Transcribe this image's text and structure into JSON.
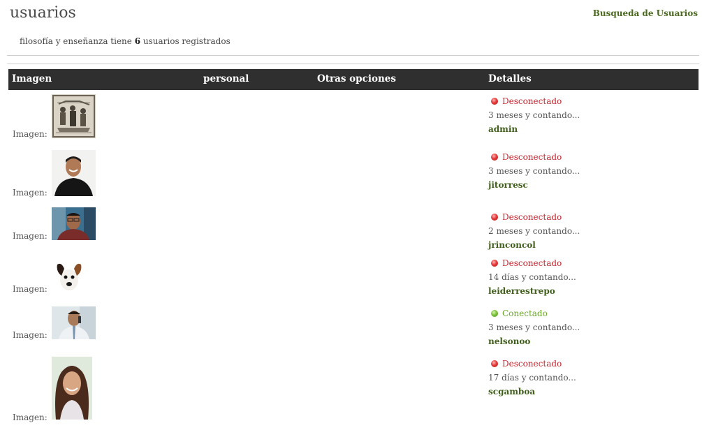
{
  "header": {
    "title": "usuarios",
    "search_link": "Busqueda de Usuarios",
    "summary_prefix": "filosofía y enseñanza tiene",
    "summary_count": "6",
    "summary_suffix": "usuarios registrados"
  },
  "table": {
    "columns": [
      "Imagen",
      "personal",
      "Otras opciones",
      "Detalles"
    ],
    "image_label": "Imagen:",
    "rows": [
      {
        "status": "Desconectado",
        "online": false,
        "time": "3 meses y contando...",
        "username": "admin",
        "avatar": "engraving-icon"
      },
      {
        "status": "Desconectado",
        "online": false,
        "time": "3 meses y contando...",
        "username": "jitorresc",
        "avatar": "man-smiling-photo"
      },
      {
        "status": "Desconectado",
        "online": false,
        "time": "2 meses y contando...",
        "username": "jrinconcol",
        "avatar": "man-glasses-photo"
      },
      {
        "status": "Desconectado",
        "online": false,
        "time": "14 días y contando...",
        "username": "leiderrestrepo",
        "avatar": "dog-photo"
      },
      {
        "status": "Conectado",
        "online": true,
        "time": "3 meses y contando...",
        "username": "nelsonoo",
        "avatar": "man-phone-photo"
      },
      {
        "status": "Desconectado",
        "online": false,
        "time": "17 días y contando...",
        "username": "scgamboa",
        "avatar": "woman-smiling-photo"
      }
    ]
  },
  "colors": {
    "header_bg": "#2f2f2f",
    "offline": "#c8232c",
    "online": "#6aa62a",
    "link": "#3f5f1a"
  }
}
